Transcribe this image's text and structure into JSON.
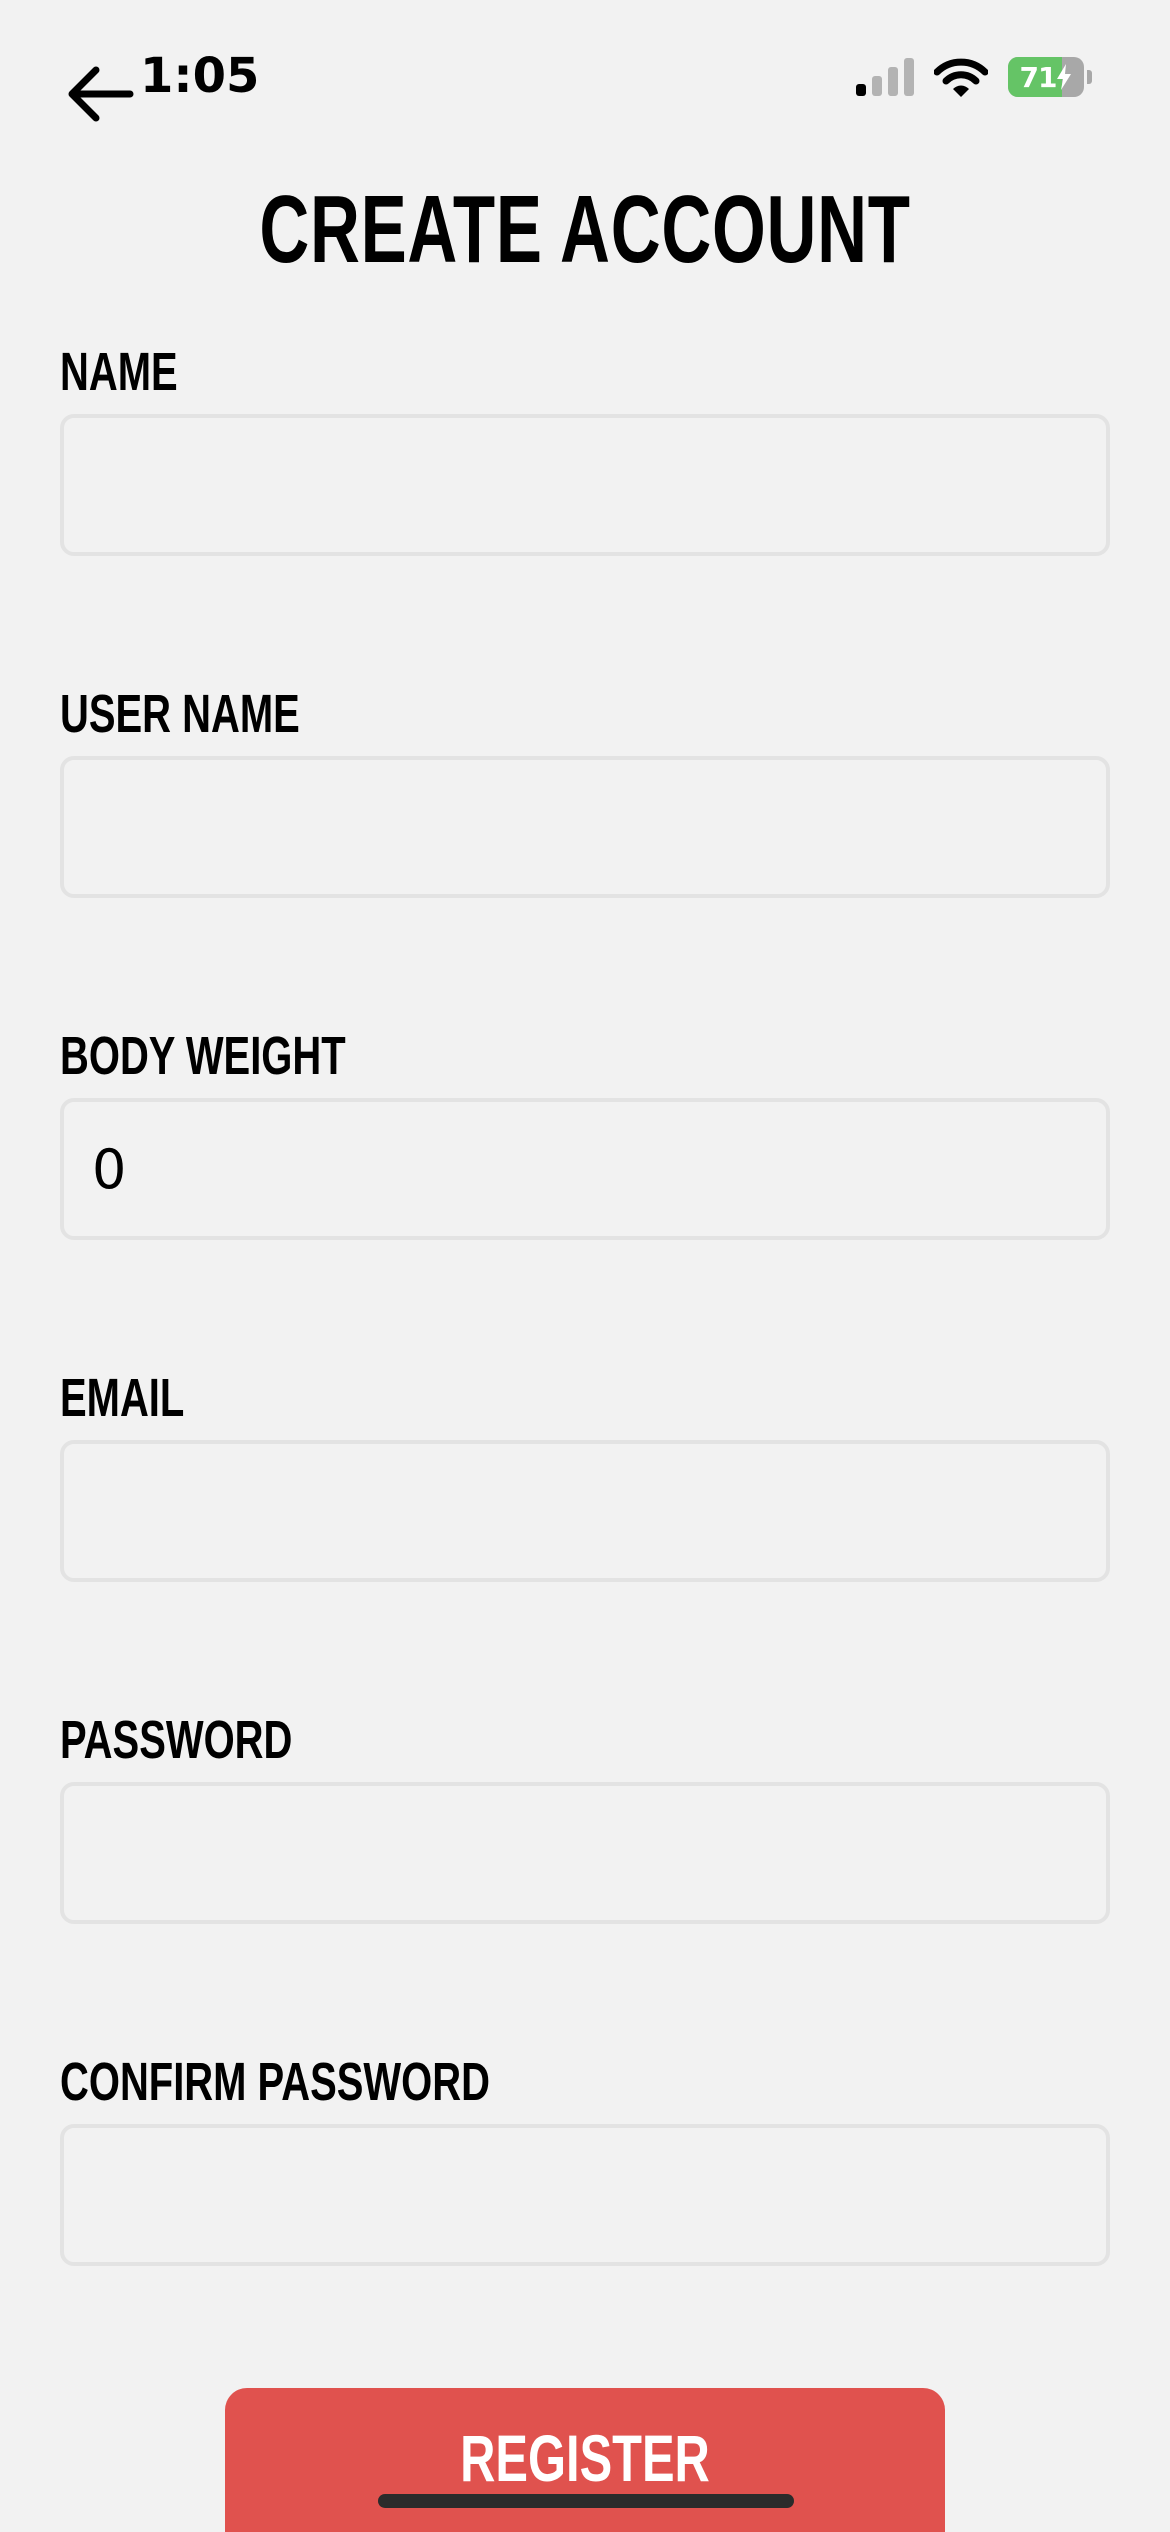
{
  "status_bar": {
    "time": "1:05",
    "battery_level": "71",
    "battery_fraction": 0.71,
    "signal_bars_active": 1,
    "signal_bars_total": 4,
    "icons": [
      "back-arrow-icon",
      "cellular-signal-icon",
      "wifi-icon",
      "battery-charging-icon"
    ]
  },
  "page": {
    "title": "CREATE ACCOUNT"
  },
  "form": {
    "fields": [
      {
        "label": "NAME",
        "value": ""
      },
      {
        "label": "USER NAME",
        "value": ""
      },
      {
        "label": "BODY WEIGHT",
        "value": "0"
      },
      {
        "label": "EMAIL",
        "value": ""
      },
      {
        "label": "PASSWORD",
        "value": ""
      },
      {
        "label": "CONFIRM PASSWORD",
        "value": ""
      }
    ],
    "submit_label": "REGISTER"
  },
  "colors": {
    "background": "#f2f2f2",
    "accent": "#e0524e",
    "battery_green": "#65c466"
  }
}
